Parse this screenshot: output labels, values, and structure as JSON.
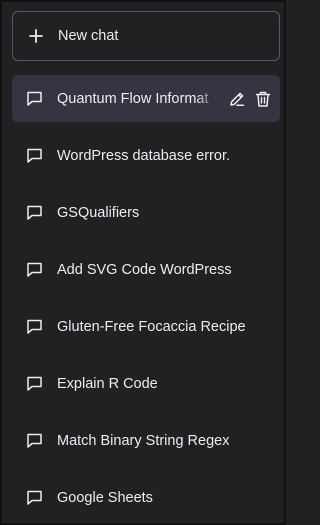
{
  "new_chat": {
    "label": "New chat",
    "icon": "plus-icon"
  },
  "chats": [
    {
      "title": "Quantum Flow Informat",
      "active": true
    },
    {
      "title": "WordPress database error."
    },
    {
      "title": "GSQualifiers"
    },
    {
      "title": "Add SVG Code WordPress"
    },
    {
      "title": "Gluten-Free Focaccia Recipe"
    },
    {
      "title": "Explain R Code"
    },
    {
      "title": "Match Binary String Regex"
    },
    {
      "title": "Google Sheets"
    }
  ],
  "icons": {
    "chat": "chat-bubble-icon",
    "edit": "pencil-icon",
    "delete": "trash-icon"
  },
  "colors": {
    "background": "#202123",
    "active_item": "#343541",
    "border": "#565869",
    "text": "#ececf1"
  }
}
